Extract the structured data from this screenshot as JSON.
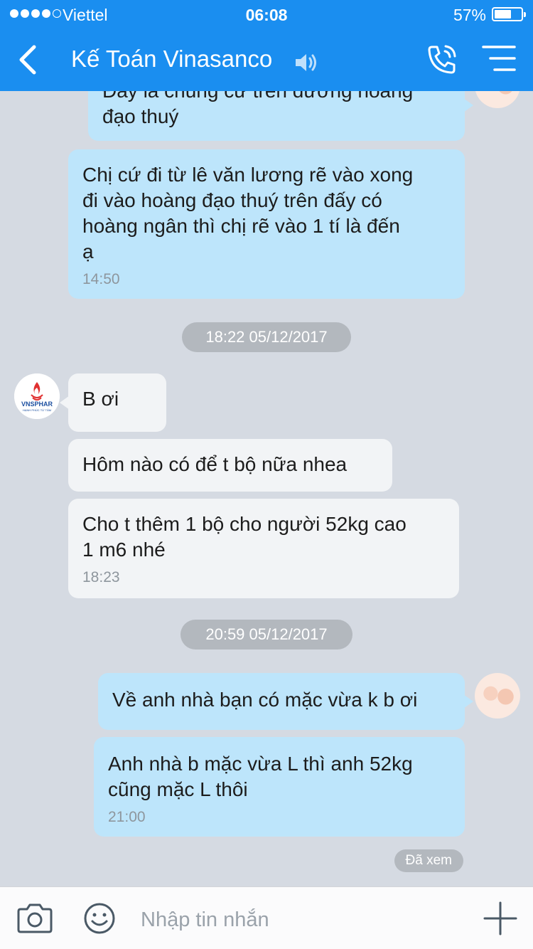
{
  "status": {
    "carrier": "Viettel",
    "time": "06:08",
    "battery": "57%",
    "battery_level": 0.57
  },
  "header": {
    "title": "Kế Toán Vinasanco"
  },
  "messages": {
    "m1": {
      "line1": "Đây là chung cư trên đường hoàng",
      "line2": "đạo thuý"
    },
    "m2": {
      "line1": "Chị cứ đi từ lê văn lương rẽ vào xong",
      "line2": "đi vào hoàng đạo thuý trên đấy có",
      "line3": "hoàng ngân thì chị rẽ vào 1 tí là đến",
      "line4": "ạ",
      "time": "14:50"
    },
    "date1": "18:22 05/12/2017",
    "m3": {
      "text": "B ơi"
    },
    "m4": {
      "text": "Hôm nào có để t bộ nữa nhea"
    },
    "m5": {
      "line1": "Cho t thêm 1 bộ cho người 52kg cao",
      "line2": "1 m6 nhé",
      "time": "18:23"
    },
    "date2": "20:59 05/12/2017",
    "m6": {
      "text": "Về anh nhà bạn có mặc vừa k b ơi"
    },
    "m7": {
      "line1": "Anh nhà b mặc vừa L thì anh 52kg",
      "line2": "cũng mặc L thôi",
      "time": "21:00"
    },
    "seen": "Đã xem"
  },
  "brand_logo": {
    "name": "VNSPHAR",
    "tagline": "HẠNH PHÚC TỪ TÂM"
  },
  "input": {
    "placeholder": "Nhập tin nhắn"
  },
  "colors": {
    "header": "#1a8ef0",
    "outgoing": "#bde5fb",
    "incoming": "#f2f4f6",
    "background": "#d5dae2"
  },
  "icons": [
    "back-arrow-icon",
    "speaker-icon",
    "phone-icon",
    "menu-icon",
    "camera-icon",
    "smiley-icon",
    "plus-icon"
  ]
}
